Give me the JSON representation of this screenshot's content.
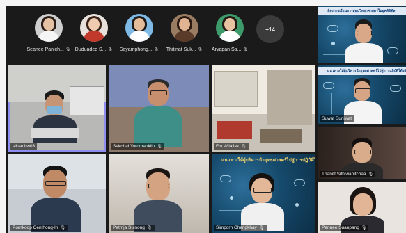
{
  "top_participants": [
    {
      "name": "Seanee Panich..."
    },
    {
      "name": "Duduadee S..."
    },
    {
      "name": "Sayamphong..."
    },
    {
      "name": "Thitinat Suk..."
    },
    {
      "name": "Aryapan Sa..."
    }
  ],
  "more_count": "+14",
  "banner_top_right": "ห้องการเรียนการสอนวิทยาศาสตร์ในยุคดิจิทัล",
  "banner_mid": "แนวทางให้ผู้บริหารนำยุทธศาสตร์ไปสู่การปฏิบัติได้จริงสำหรับ",
  "banner_bottom": "แนวทางให้ผู้บริหารนำยุทธศาสตร์ไปสู่การปฏิบัติได้",
  "tiles": [
    {
      "name": "siluanitw03"
    },
    {
      "name": "Sakchai Yordmanklin"
    },
    {
      "name": "Fin Wilailak"
    },
    {
      "name": "Suwat Suniwat"
    },
    {
      "name": "Thanitt Sithiwanitchaa"
    },
    {
      "name": "Pornkoop Centhong-In"
    },
    {
      "name": "Patmja Suinong"
    },
    {
      "name": "Simporn Chengkhay"
    },
    {
      "name": "Pannee Suanpang"
    }
  ],
  "icons": {
    "mute": "microphone-muted-icon"
  },
  "colors": {
    "window_bg": "#1a1a1a",
    "active_speaker_border": "#8e8ef0",
    "tech_blue": "#164a6c"
  }
}
